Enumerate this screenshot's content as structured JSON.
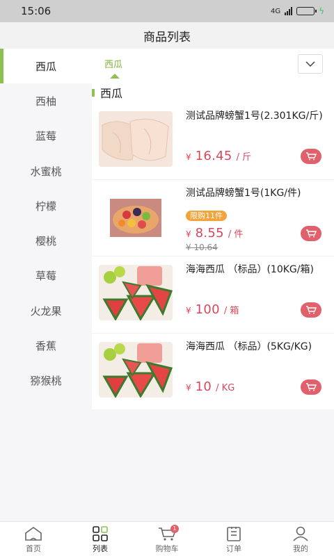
{
  "status_bar": {
    "time": "15:06",
    "signal_text": "4G",
    "battery_color": "#33c76b"
  },
  "header": {
    "title": "商品列表"
  },
  "sidebar": {
    "items": [
      {
        "label": "西瓜",
        "active": true
      },
      {
        "label": "西柚"
      },
      {
        "label": "蓝莓"
      },
      {
        "label": "水蜜桃"
      },
      {
        "label": "柠檬"
      },
      {
        "label": "樱桃"
      },
      {
        "label": "草莓"
      },
      {
        "label": "火龙果"
      },
      {
        "label": "香蕉"
      },
      {
        "label": "猕猴桃"
      }
    ]
  },
  "subtabs": {
    "active_label": "西瓜"
  },
  "section": {
    "title": "西瓜"
  },
  "products": [
    {
      "name": "测试品牌螃蟹1号(2.301KG/斤)",
      "yen": "¥",
      "price": "16.45",
      "unit": "/ 斤",
      "image": "crab-meat-photo"
    },
    {
      "name": "测试品牌螃蟹1号(1KG/件)",
      "badge": "限购11件",
      "yen": "¥",
      "price": "8.55",
      "unit": "/ 件",
      "old_price": "¥ 10.64",
      "image": "fruit-bowl-photo"
    },
    {
      "name": "海海西瓜 （标品）(10KG/箱)",
      "yen": "¥",
      "price": "100",
      "unit": "/ 箱",
      "image": "watermelon-photo"
    },
    {
      "name": "海海西瓜 （标品）(5KG/KG)",
      "yen": "¥",
      "price": "10",
      "unit": "/ KG",
      "image": "watermelon-photo"
    }
  ],
  "bottom_nav": {
    "items": [
      {
        "label": "首页",
        "icon": "home-icon"
      },
      {
        "label": "列表",
        "icon": "grid-icon",
        "active": true
      },
      {
        "label": "购物车",
        "icon": "cart-icon",
        "badge": "1"
      },
      {
        "label": "订单",
        "icon": "order-icon"
      },
      {
        "label": "我的",
        "icon": "user-icon"
      }
    ]
  },
  "colors": {
    "accent_green": "#8ec152",
    "price_red": "#d7475b",
    "cart_red": "#e0606b",
    "badge_orange": "#f2a33a"
  }
}
